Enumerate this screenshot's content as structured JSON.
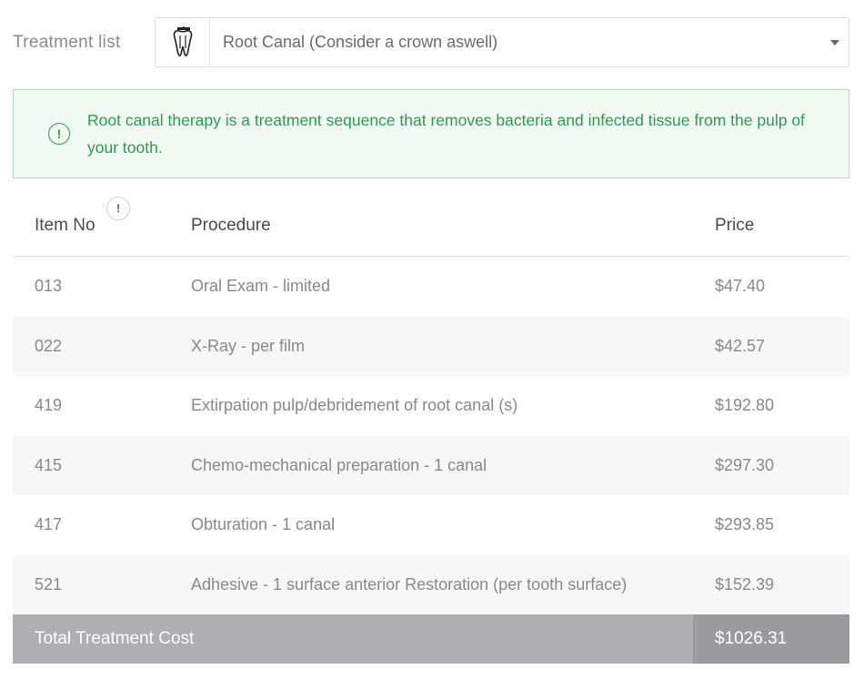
{
  "selector": {
    "label": "Treatment list",
    "selected": "Root Canal (Consider a crown aswell)"
  },
  "alert": {
    "text": "Root canal therapy is a treatment sequence that removes bacteria and infected tissue from the pulp of your tooth."
  },
  "table": {
    "headers": {
      "item_no": "Item No",
      "procedure": "Procedure",
      "price": "Price"
    },
    "rows": [
      {
        "item_no": "013",
        "procedure": "Oral Exam - limited",
        "price": "$47.40"
      },
      {
        "item_no": "022",
        "procedure": "X-Ray - per film",
        "price": "$42.57"
      },
      {
        "item_no": "419",
        "procedure": "Extirpation pulp/debridement of root canal (s)",
        "price": "$192.80"
      },
      {
        "item_no": "415",
        "procedure": "Chemo-mechanical preparation - 1 canal",
        "price": "$297.30"
      },
      {
        "item_no": "417",
        "procedure": "Obturation - 1 canal",
        "price": "$293.85"
      },
      {
        "item_no": "521",
        "procedure": "Adhesive - 1 surface anterior Restoration (per tooth surface)",
        "price": "$152.39"
      }
    ],
    "total": {
      "label": "Total Treatment Cost",
      "value": "$1026.31"
    }
  },
  "icons": {
    "tooth": "tooth-root-canal-icon",
    "alert": "info-exclamation-icon",
    "header_info": "info-exclamation-icon",
    "caret": "chevron-down-icon"
  },
  "colors": {
    "alert_text": "#2e9a4e",
    "alert_bg": "#f1f9f3",
    "alert_border": "#b3dcbf",
    "total_bg": "#aeaeb3",
    "total_value_bg": "#9a9a9f"
  }
}
